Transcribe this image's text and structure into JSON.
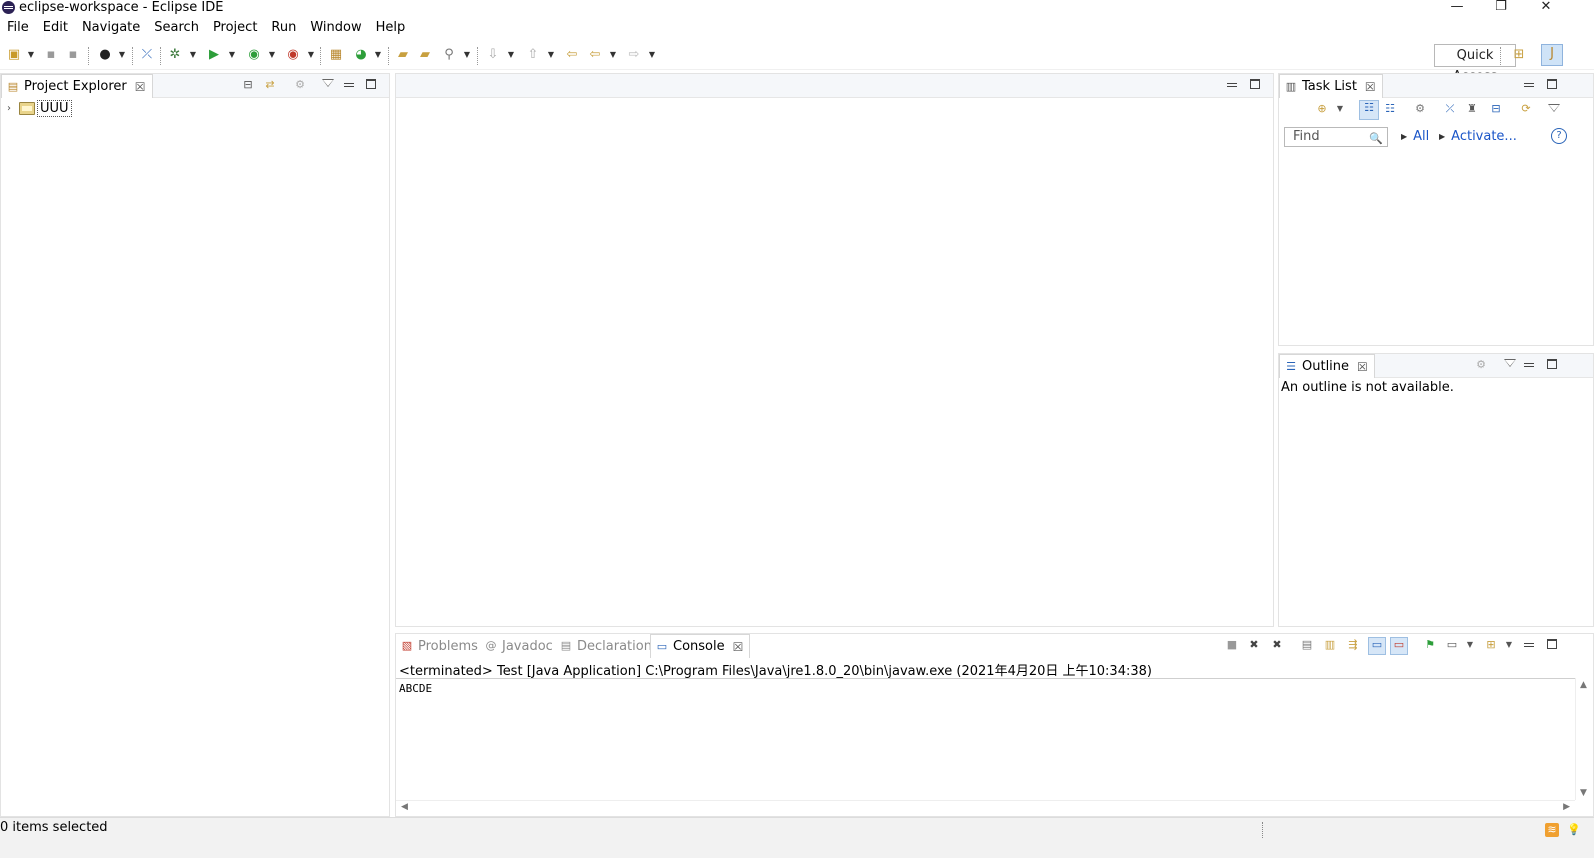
{
  "window": {
    "title": "eclipse-workspace - Eclipse IDE",
    "controls": {
      "minimize": "—",
      "restore": "❐",
      "close": "✕"
    }
  },
  "menu": [
    "File",
    "Edit",
    "Navigate",
    "Search",
    "Project",
    "Run",
    "Window",
    "Help"
  ],
  "toolbar": {
    "quick_access": "Quick Access",
    "icons": [
      "new-icon",
      "save-icon",
      "save-all-icon",
      "profile-icon",
      "skip-breakpoints-icon",
      "debug-icon",
      "run-icon",
      "coverage-icon",
      "external-tools-icon",
      "new-java-package-icon",
      "new-java-class-icon",
      "open-type-icon",
      "open-task-icon",
      "search-icon",
      "next-annotation-icon",
      "previous-annotation-icon",
      "last-edit-location-icon",
      "back-icon",
      "forward-icon",
      "open-perspective-icon",
      "java-perspective-icon"
    ]
  },
  "project_explorer": {
    "tab": "Project Explorer",
    "close": "☒",
    "items": [
      {
        "label": "UUU"
      }
    ]
  },
  "task_list": {
    "tab": "Task List",
    "close": "☒",
    "find_placeholder": "Find",
    "filters": [
      "All",
      "Activate..."
    ],
    "help": "?"
  },
  "outline": {
    "tab": "Outline",
    "close": "☒",
    "message": "An outline is not available."
  },
  "bottom_tabs": [
    {
      "label": "Problems",
      "active": false
    },
    {
      "label": "Javadoc",
      "active": false
    },
    {
      "label": "Declaration",
      "active": false
    },
    {
      "label": "Console",
      "active": true
    }
  ],
  "console": {
    "close": "☒",
    "description": "<terminated> Test [Java Application] C:\\Program Files\\Java\\jre1.8.0_20\\bin\\javaw.exe (2021年4月20日 上午10:34:38)",
    "output": "ABCDE"
  },
  "status": {
    "selection": "0 items selected"
  }
}
